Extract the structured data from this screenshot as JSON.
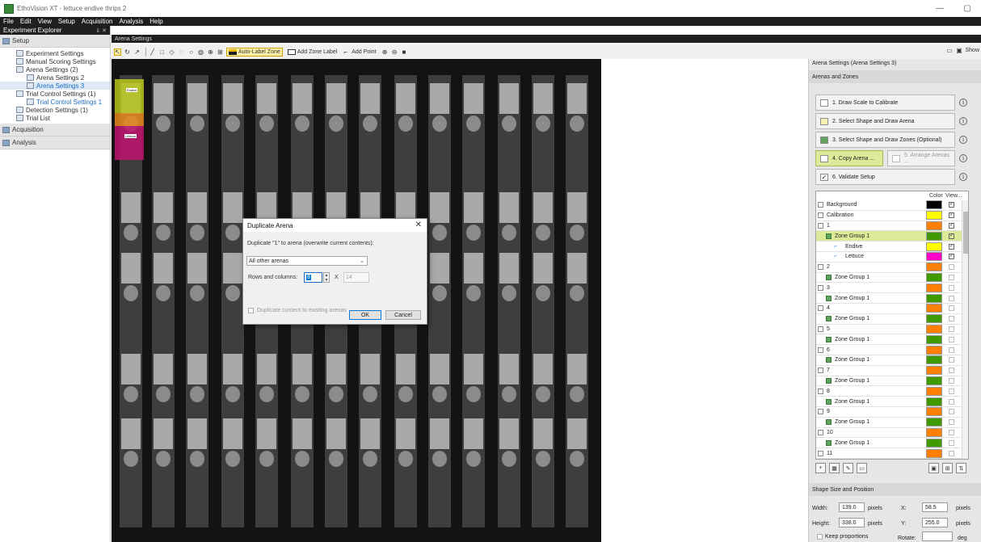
{
  "window": {
    "title": "EthoVision XT - lettuce endive thrips 2",
    "minimize_glyph": "—",
    "restore_glyph": "▢"
  },
  "menu": [
    "File",
    "Edit",
    "View",
    "Setup",
    "Acquisition",
    "Analysis",
    "Help"
  ],
  "explorer": {
    "title": "Experiment Explorer",
    "pins": "⇓ ✕",
    "setup_label": "Setup",
    "tree": [
      {
        "label": "Experiment Settings",
        "indent": 1,
        "icon": "settings-icon"
      },
      {
        "label": "Manual Scoring Settings",
        "indent": 1,
        "icon": "scoring-icon"
      },
      {
        "label": "Arena Settings (2)",
        "indent": 1,
        "icon": "arena-folder-icon"
      },
      {
        "label": "Arena Settings 2",
        "indent": 2,
        "icon": "arena-icon",
        "link": false
      },
      {
        "label": "Arena Settings 3",
        "indent": 2,
        "icon": "arena-icon",
        "link": true,
        "selected": true
      },
      {
        "label": "Trial Control Settings (1)",
        "indent": 1,
        "icon": "trial-control-folder-icon"
      },
      {
        "label": "Trial Control Settings 1",
        "indent": 2,
        "icon": "trial-control-icon",
        "link": true
      },
      {
        "label": "Detection Settings (1)",
        "indent": 1,
        "icon": "detection-icon"
      },
      {
        "label": "Trial List",
        "indent": 1,
        "icon": "trial-list-icon"
      }
    ],
    "acquisition_label": "Acquisition",
    "analysis_label": "Analysis"
  },
  "document": {
    "tab_label": "Arena Settings"
  },
  "toolbar": {
    "auto_label_zone": "Auto-Label Zone",
    "add_zone_label": "Add Zone Label",
    "add_point": "Add Point",
    "show_label": "Show",
    "auto_label_color": "#e9b800"
  },
  "dialog": {
    "title": "Duplicate Arena",
    "close": "✕",
    "prompt": "Duplicate \"1\" to arena (overwrite current contents):",
    "target_select": "All other arenas",
    "rows_columns_label": "Rows and columns:",
    "rows_value": "8",
    "x_label": "X",
    "columns_value": "14",
    "duplicate_content_label": "Duplicate content to existing arenas",
    "ok": "OK",
    "cancel": "Cancel"
  },
  "right_panel": {
    "title": "Arena Settings (Arena Settings 3)",
    "section": "Arenas and Zones",
    "steps": [
      {
        "label": "1. Draw Scale to Calibrate",
        "icon": "ruler-icon"
      },
      {
        "label": "2. Select Shape and Draw Arena",
        "icon": "arena-shape-icon"
      },
      {
        "label": "3. Select Shape and Draw Zones (Optional)",
        "icon": "zone-shape-icon"
      },
      {
        "label": "4. Copy Arena ...",
        "icon": "copy-arena-icon",
        "highlight": true
      },
      {
        "label": "5. Arrange Arenas ...",
        "icon": "arrange-arenas-icon",
        "disabled": true
      },
      {
        "label": "6. Validate Setup",
        "icon": "validate-icon"
      }
    ],
    "info_glyph": "i",
    "layers": {
      "color_header": "Color",
      "view_header": "View...",
      "rows": [
        {
          "label": "Background",
          "level": 0,
          "color": "#000000",
          "checked": true
        },
        {
          "label": "Calibration",
          "level": 0,
          "color": "#ffff00",
          "checked": true
        },
        {
          "label": "1",
          "level": 0,
          "color": "#ff8000",
          "checked": true
        },
        {
          "label": "Zone Group 1",
          "level": 1,
          "color": "#3f9a00",
          "checked": true,
          "highlight": true,
          "group": true
        },
        {
          "label": "Endive",
          "level": 2,
          "color": "#ffff00",
          "checked": true,
          "zone": true
        },
        {
          "label": "Lettuce",
          "level": 2,
          "color": "#ff00c8",
          "checked": true,
          "zone": true
        },
        {
          "label": "2",
          "level": 0,
          "color": "#ff8000",
          "checked": false
        },
        {
          "label": "Zone Group 1",
          "level": 1,
          "color": "#3f9a00",
          "checked": false,
          "group": true
        },
        {
          "label": "3",
          "level": 0,
          "color": "#ff8000",
          "checked": false
        },
        {
          "label": "Zone Group 1",
          "level": 1,
          "color": "#3f9a00",
          "checked": false,
          "group": true
        },
        {
          "label": "4",
          "level": 0,
          "color": "#ff8000",
          "checked": false
        },
        {
          "label": "Zone Group 1",
          "level": 1,
          "color": "#3f9a00",
          "checked": false,
          "group": true
        },
        {
          "label": "5",
          "level": 0,
          "color": "#ff8000",
          "checked": false
        },
        {
          "label": "Zone Group 1",
          "level": 1,
          "color": "#3f9a00",
          "checked": false,
          "group": true
        },
        {
          "label": "6",
          "level": 0,
          "color": "#ff8000",
          "checked": false
        },
        {
          "label": "Zone Group 1",
          "level": 1,
          "color": "#3f9a00",
          "checked": false,
          "group": true
        },
        {
          "label": "7",
          "level": 0,
          "color": "#ff8000",
          "checked": false
        },
        {
          "label": "Zone Group 1",
          "level": 1,
          "color": "#3f9a00",
          "checked": false,
          "group": true
        },
        {
          "label": "8",
          "level": 0,
          "color": "#ff8000",
          "checked": false
        },
        {
          "label": "Zone Group 1",
          "level": 1,
          "color": "#3f9a00",
          "checked": false,
          "group": true
        },
        {
          "label": "9",
          "level": 0,
          "color": "#ff8000",
          "checked": false
        },
        {
          "label": "Zone Group 1",
          "level": 1,
          "color": "#3f9a00",
          "checked": false,
          "group": true
        },
        {
          "label": "10",
          "level": 0,
          "color": "#ff8000",
          "checked": false
        },
        {
          "label": "Zone Group 1",
          "level": 1,
          "color": "#3f9a00",
          "checked": false,
          "group": true
        },
        {
          "label": "11",
          "level": 0,
          "color": "#ff8000",
          "checked": false
        }
      ]
    },
    "shape_section": "Shape Size and Position",
    "width_label": "Width:",
    "width_value": "139.0",
    "height_label": "Height:",
    "height_value": "338.0",
    "pixels_label": "pixels",
    "x_label": "X:",
    "x_value": "58.5",
    "y_label": "Y:",
    "y_value": "255.0",
    "keep_proportions": "Keep proportions",
    "rotate_label": "Rotate:",
    "rotate_unit": "deg"
  },
  "video_labels": {
    "endive_zone": "Endive",
    "lettuce_zone": "Lettuce"
  }
}
